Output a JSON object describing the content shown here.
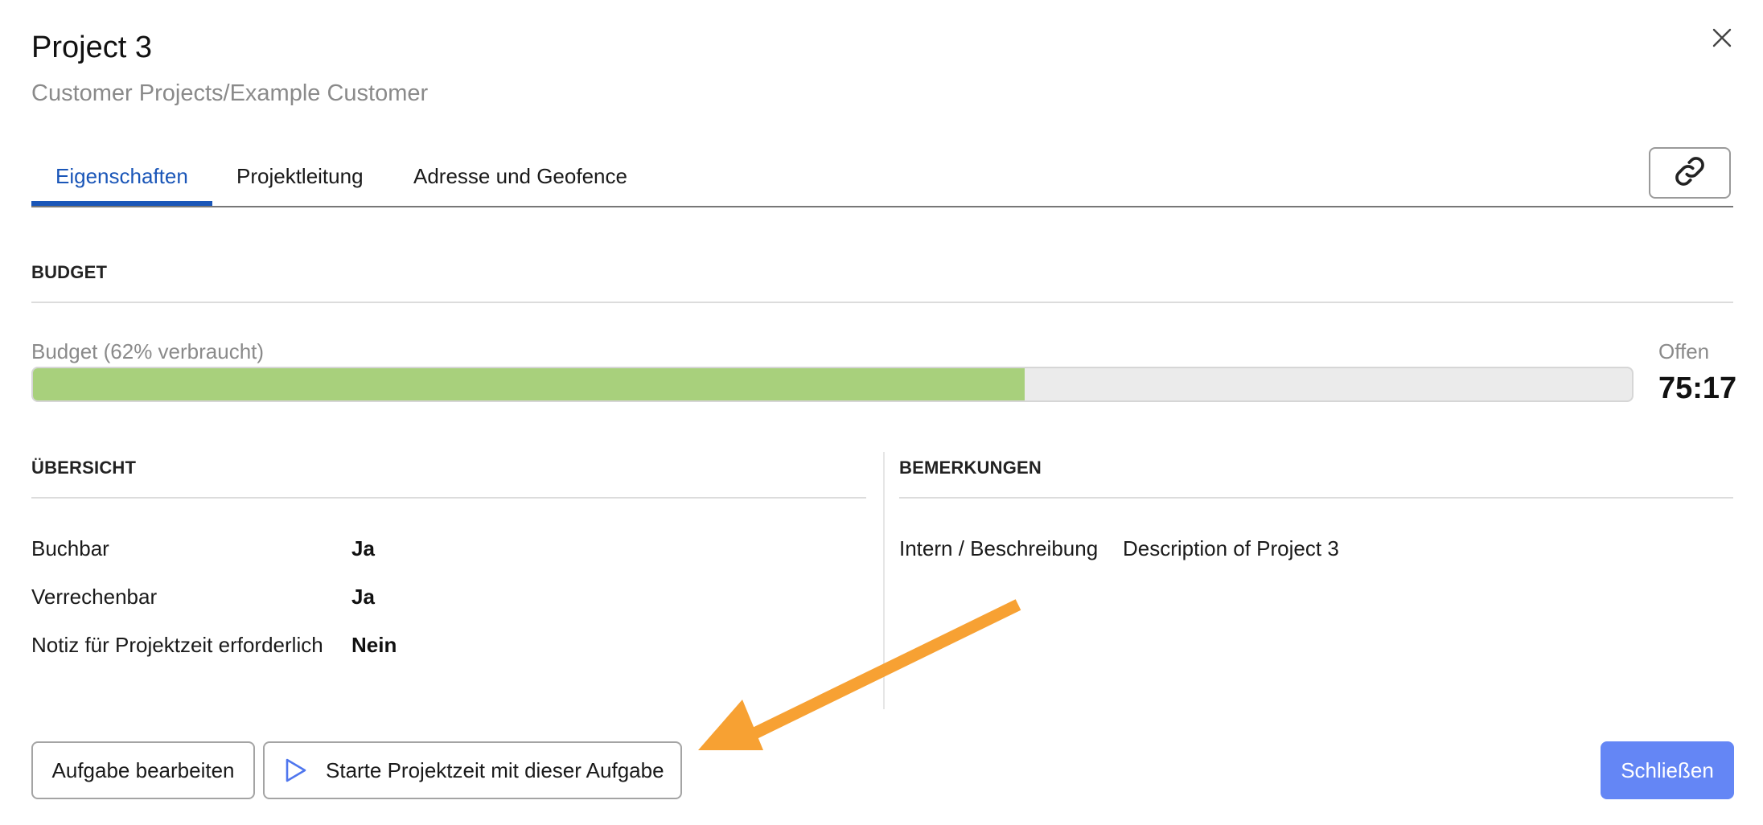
{
  "header": {
    "title": "Project 3",
    "subtitle": "Customer Projects/Example Customer",
    "close_icon": "close-icon"
  },
  "tabs": [
    {
      "label": "Eigenschaften",
      "active": true
    },
    {
      "label": "Projektleitung",
      "active": false
    },
    {
      "label": "Adresse und Geofence",
      "active": false
    }
  ],
  "link_button": {
    "icon": "link-icon"
  },
  "budget": {
    "section_title": "BUDGET",
    "label": "Budget (62% verbraucht)",
    "used_percent": 62,
    "open_label": "Offen",
    "open_value": "75:17",
    "fill_color": "#a8d07c"
  },
  "overview": {
    "section_title": "ÜBERSICHT",
    "rows": [
      {
        "label": "Buchbar",
        "value": "Ja"
      },
      {
        "label": "Verrechenbar",
        "value": "Ja"
      },
      {
        "label": "Notiz für Projektzeit erforderlich",
        "value": "Nein"
      }
    ]
  },
  "remarks": {
    "section_title": "BEMERKUNGEN",
    "label": "Intern / Beschreibung",
    "value": "Description of Project 3"
  },
  "actions": {
    "edit_label": "Aufgabe bearbeiten",
    "start_label": "Starte Projektzeit mit dieser Aufgabe",
    "start_icon": "play-icon",
    "close_label": "Schließen"
  },
  "colors": {
    "accent": "#1a56b8",
    "primary_button": "#6486f5",
    "annotation_arrow": "#f7a133"
  }
}
